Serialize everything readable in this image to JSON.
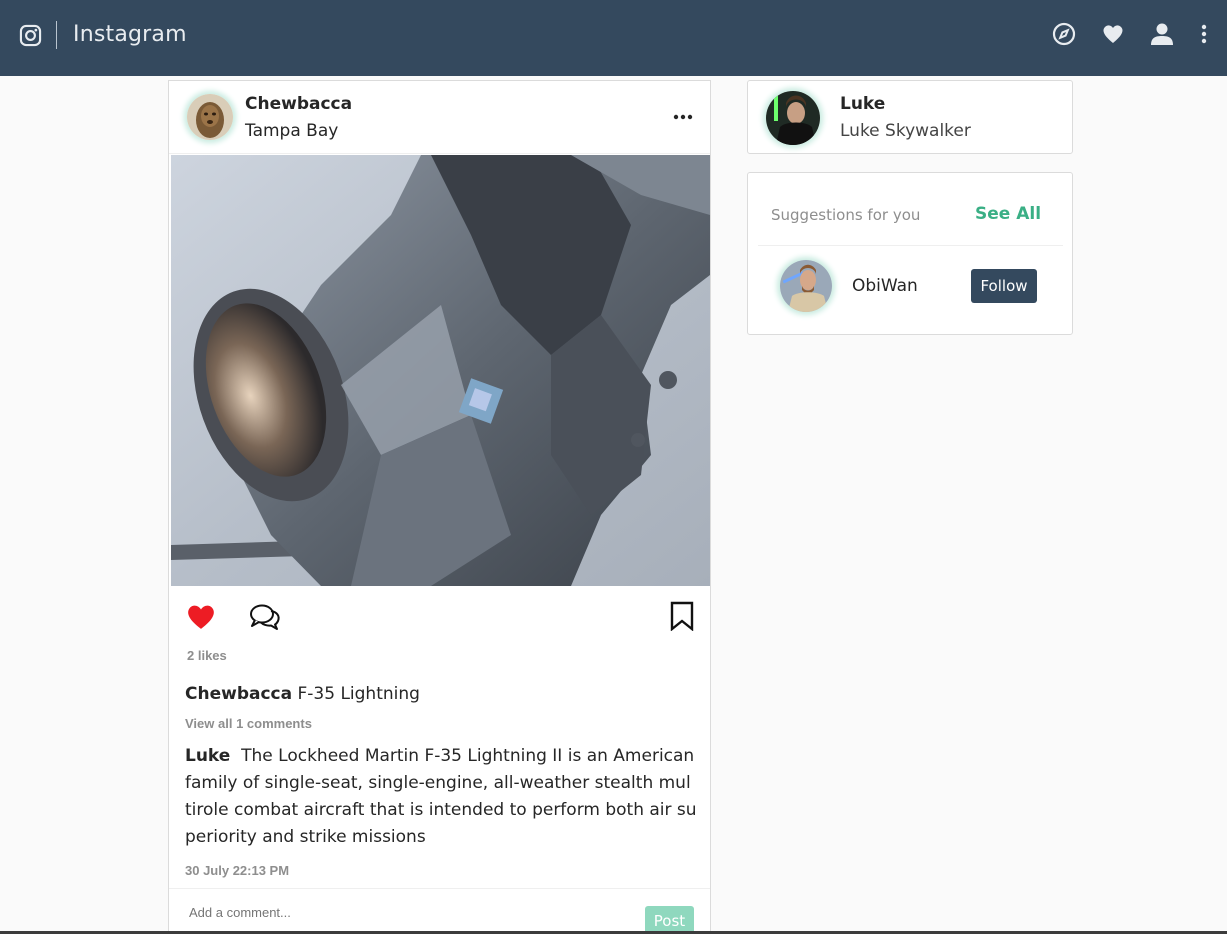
{
  "app": {
    "title": "Instagram"
  },
  "nav": {
    "icons": [
      "explore-compass-icon",
      "activity-heart-icon",
      "profile-icon",
      "more-vertical-icon"
    ]
  },
  "post": {
    "username": "Chewbacca",
    "location": "Tampa Bay",
    "likes": "2 likes",
    "caption_username": "Chewbacca",
    "caption_text": "F-35 Lightning",
    "view_comments": "View all 1 comments",
    "comment_username": "Luke",
    "comment_text": "The Lockheed Martin F-35 Lightning II is an American family of single-seat, single-engine, all-weather stealth multirole combat aircraft that is intended to perform both air superiority and strike missions",
    "timestamp": "30 July 22:13 PM",
    "comment_placeholder": "Add a comment...",
    "post_label": "Post",
    "liked": true
  },
  "profile": {
    "username": "Luke",
    "fullname": "Luke Skywalker"
  },
  "suggestions": {
    "title": "Suggestions for you",
    "see_all": "See All",
    "items": [
      {
        "username": "ObiWan",
        "follow_label": "Follow"
      }
    ]
  },
  "colors": {
    "topbar": "#34495e",
    "accent": "#3aaf85",
    "like": "#ed1c24",
    "post_button": "#8fd8be"
  }
}
